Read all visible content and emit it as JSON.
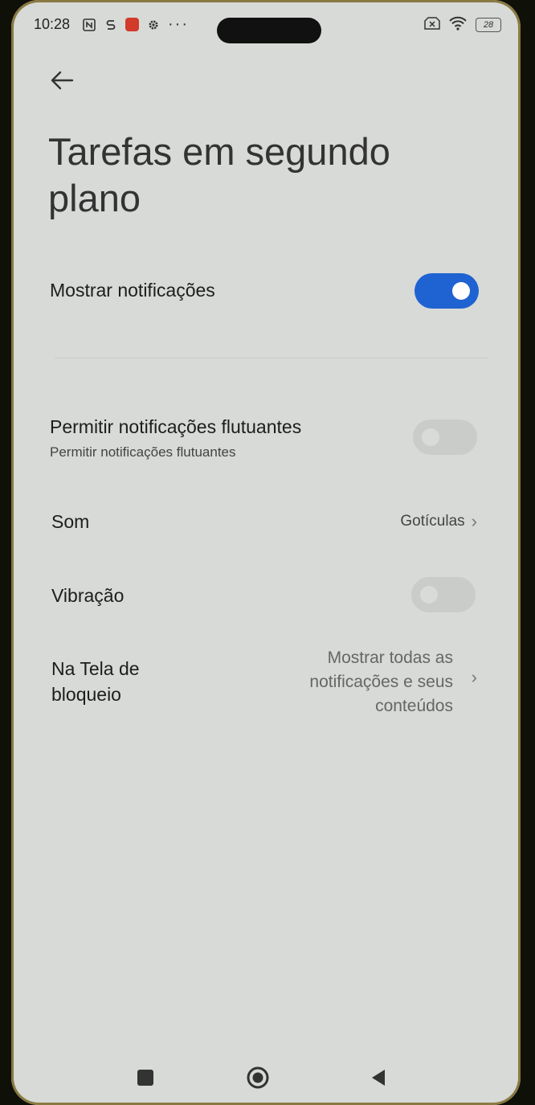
{
  "status_bar": {
    "time": "10:28",
    "battery": "28"
  },
  "page": {
    "title": "Tarefas em segundo plano"
  },
  "settings": {
    "show_notifications": {
      "label": "Mostrar notificações",
      "enabled": true
    },
    "floating_notifications": {
      "label": "Permitir notificações flutuantes",
      "sublabel": "Permitir notificações flutuantes",
      "enabled": false
    },
    "sound": {
      "label": "Som",
      "value": "Gotículas"
    },
    "vibration": {
      "label": "Vibração",
      "enabled": false
    },
    "lock_screen": {
      "label_line1": "Na Tela de",
      "label_line2": "bloqueio",
      "value_line1": "Mostrar todas as",
      "value_line2": "notificações e seus",
      "value_line3": "conteúdos"
    }
  },
  "colors": {
    "accent": "#1f62d2",
    "background": "#d7dad6"
  }
}
